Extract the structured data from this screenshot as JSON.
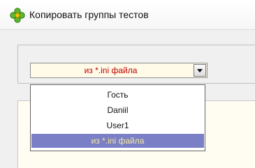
{
  "window": {
    "title": "Копировать группы тестов",
    "icon": "green-flower-icon"
  },
  "combo": {
    "value": "из *.ini файла",
    "button_icon": "dropdown-arrow-icon"
  },
  "dropdown": {
    "items": [
      {
        "label": "Гость",
        "selected": false
      },
      {
        "label": "Daniil",
        "selected": false
      },
      {
        "label": "User1",
        "selected": false
      },
      {
        "label": "из *.ini файла",
        "selected": true
      }
    ]
  },
  "colors": {
    "selected_bg": "#7b7fc6",
    "selected_text": "#f3e9a0",
    "combo_text": "#c00000"
  }
}
